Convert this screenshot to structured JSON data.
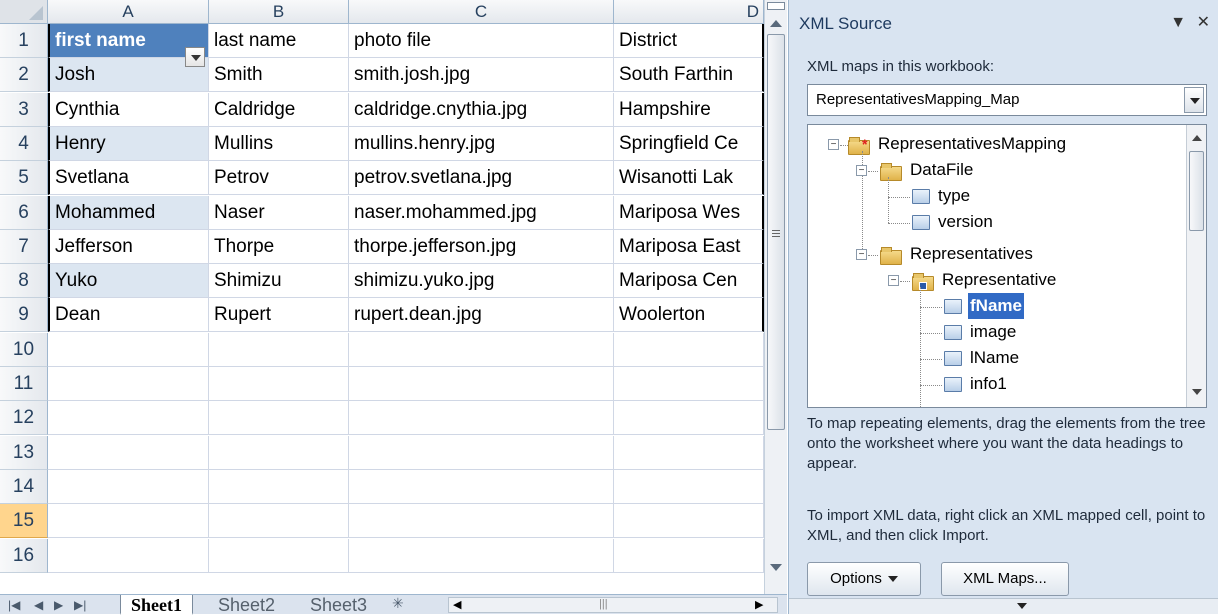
{
  "sheet": {
    "columns": [
      "A",
      "B",
      "C",
      "D"
    ],
    "row_numbers": [
      "1",
      "2",
      "3",
      "4",
      "5",
      "6",
      "7",
      "8",
      "9",
      "10",
      "11",
      "12",
      "13",
      "14",
      "15",
      "16"
    ],
    "selected_row": "15",
    "rows": [
      [
        "first name",
        "last name",
        "photo file",
        "District"
      ],
      [
        "Josh",
        "Smith",
        "smith.josh.jpg",
        "South Farthin"
      ],
      [
        "Cynthia",
        "Caldridge",
        "caldridge.cnythia.jpg",
        "Hampshire"
      ],
      [
        "Henry",
        "Mullins",
        "mullins.henry.jpg",
        "Springfield Ce"
      ],
      [
        "Svetlana",
        "Petrov",
        "petrov.svetlana.jpg",
        "Wisanotti Lak"
      ],
      [
        "Mohammed",
        "Naser",
        "naser.mohammed.jpg",
        "Mariposa Wes"
      ],
      [
        "Jefferson",
        "Thorpe",
        "thorpe.jefferson.jpg",
        "Mariposa East"
      ],
      [
        "Yuko",
        "Shimizu",
        "shimizu.yuko.jpg",
        "Mariposa Cen"
      ],
      [
        "Dean",
        "Rupert",
        "rupert.dean.jpg",
        "Woolerton"
      ]
    ],
    "tabs": [
      "Sheet1",
      "Sheet2",
      "Sheet3"
    ],
    "active_tab": "Sheet1",
    "header_fill_color": "#4f81bd",
    "band_fill_color": "#dce6f1"
  },
  "panel": {
    "title": "XML Source",
    "maps_label": "XML maps in this workbook:",
    "selected_map": "RepresentativesMapping_Map",
    "tree": [
      {
        "label": "RepresentativesMapping",
        "icon": "root-folder-icon"
      },
      {
        "label": "DataFile",
        "icon": "folder-icon"
      },
      {
        "label": "type",
        "icon": "element-icon"
      },
      {
        "label": "version",
        "icon": "element-icon"
      },
      {
        "label": "Representatives",
        "icon": "folder-icon"
      },
      {
        "label": "Representative",
        "icon": "repeating-folder-icon"
      },
      {
        "label": "fName",
        "icon": "element-icon",
        "selected": true
      },
      {
        "label": "image",
        "icon": "element-icon"
      },
      {
        "label": "lName",
        "icon": "element-icon"
      },
      {
        "label": "info1",
        "icon": "element-icon"
      }
    ],
    "help_map": "To map repeating elements, drag the elements from the tree onto the worksheet where you want the data headings to appear.",
    "help_import": "To import XML data, right click an XML mapped cell, point to XML, and then click Import.",
    "options_label": "Options",
    "xml_maps_label": "XML Maps...",
    "selection_color": "#316ac5"
  }
}
